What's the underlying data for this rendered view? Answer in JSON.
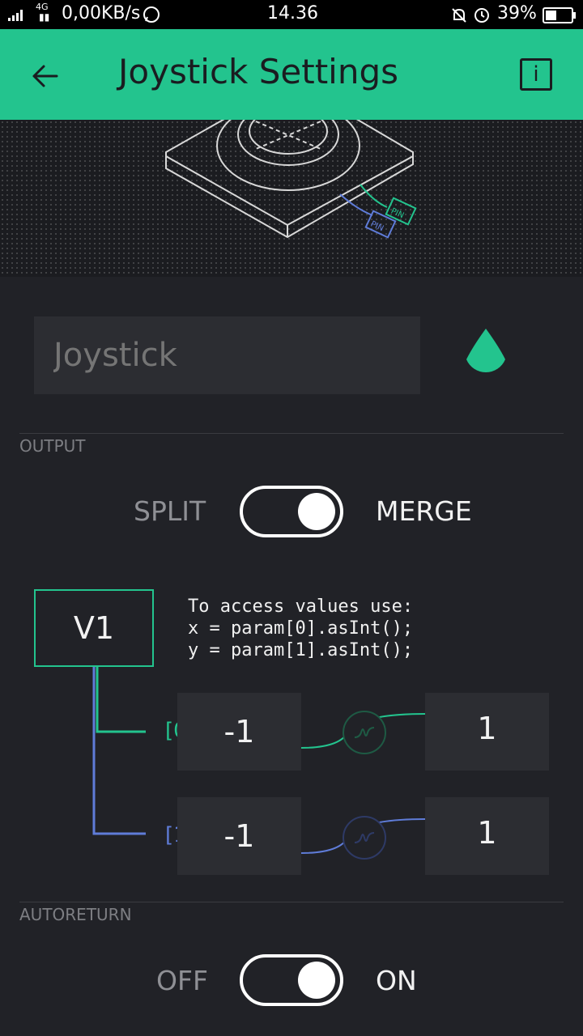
{
  "status_bar": {
    "network": "4G",
    "speed": "0,00KB/s",
    "time": "14.36",
    "battery_percent": "39%"
  },
  "app_bar": {
    "title": "Joystick Settings",
    "info_label": "i"
  },
  "name_field": {
    "placeholder": "Joystick",
    "color": "#23c48e"
  },
  "output": {
    "section_label": "OUTPUT",
    "toggle_off_label": "SPLIT",
    "toggle_on_label": "MERGE",
    "toggle_state": "on",
    "pin": "V1",
    "help_text": "To access values use:\nx = param[0].asInt();\ny = param[1].asInt();",
    "channels": [
      {
        "index": "[0]",
        "min": "-1",
        "max": "1",
        "color": "#23c48e"
      },
      {
        "index": "[1]",
        "min": "-1",
        "max": "1",
        "color": "#5f7cd8"
      }
    ]
  },
  "autoreturn": {
    "section_label": "AUTORETURN",
    "toggle_off_label": "OFF",
    "toggle_on_label": "ON",
    "toggle_state": "on"
  },
  "colors": {
    "accent": "#23c48e",
    "secondary": "#5f7cd8",
    "background": "#212227"
  }
}
